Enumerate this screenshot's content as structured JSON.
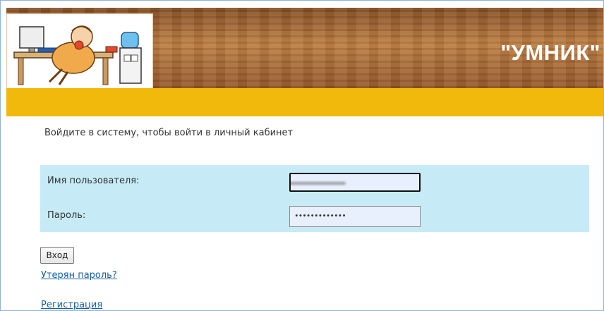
{
  "header": {
    "site_title": "\"УМНИК\"",
    "logo_icon": "person-at-computer-icon"
  },
  "colors": {
    "gold_bar": "#f0b90b",
    "form_background": "#c6ebf7",
    "link": "#1a5ea8",
    "wood": "#9a602f"
  },
  "intro_text": "Войдите в систему, чтобы войти в личный кабинет",
  "login": {
    "username_label": "Имя пользователя:",
    "username_value": "",
    "password_label": "Пароль:",
    "password_value": "•••••••••••••",
    "submit_label": "Вход"
  },
  "links": {
    "lost_password": "Утерян пароль?",
    "register": "Регистрация"
  }
}
